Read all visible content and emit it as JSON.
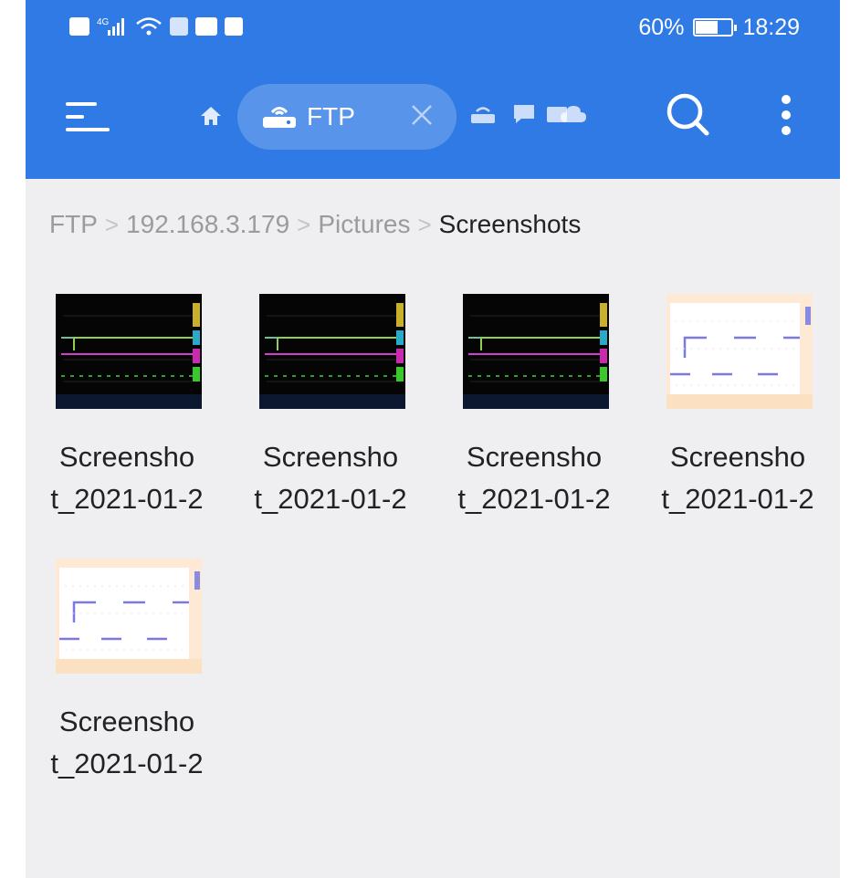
{
  "status_bar": {
    "battery_percent": "60%",
    "time": "18:29"
  },
  "toolbar": {
    "location_label": "FTP"
  },
  "breadcrumb": [
    {
      "label": "FTP"
    },
    {
      "label": "192.168.3.179"
    },
    {
      "label": "Pictures"
    },
    {
      "label": "Screenshots"
    }
  ],
  "files": [
    {
      "name_line1": "Screensho",
      "name_line2": "t_2021-01-2",
      "thumb": "dark-oscilloscope"
    },
    {
      "name_line1": "Screensho",
      "name_line2": "t_2021-01-2",
      "thumb": "dark-oscilloscope"
    },
    {
      "name_line1": "Screensho",
      "name_line2": "t_2021-01-2",
      "thumb": "dark-oscilloscope"
    },
    {
      "name_line1": "Screensho",
      "name_line2": "t_2021-01-2",
      "thumb": "light-oscilloscope"
    },
    {
      "name_line1": "Screensho",
      "name_line2": "t_2021-01-2",
      "thumb": "light-oscilloscope"
    }
  ],
  "colors": {
    "header": "#2f7ae5",
    "background": "#efeff2"
  }
}
